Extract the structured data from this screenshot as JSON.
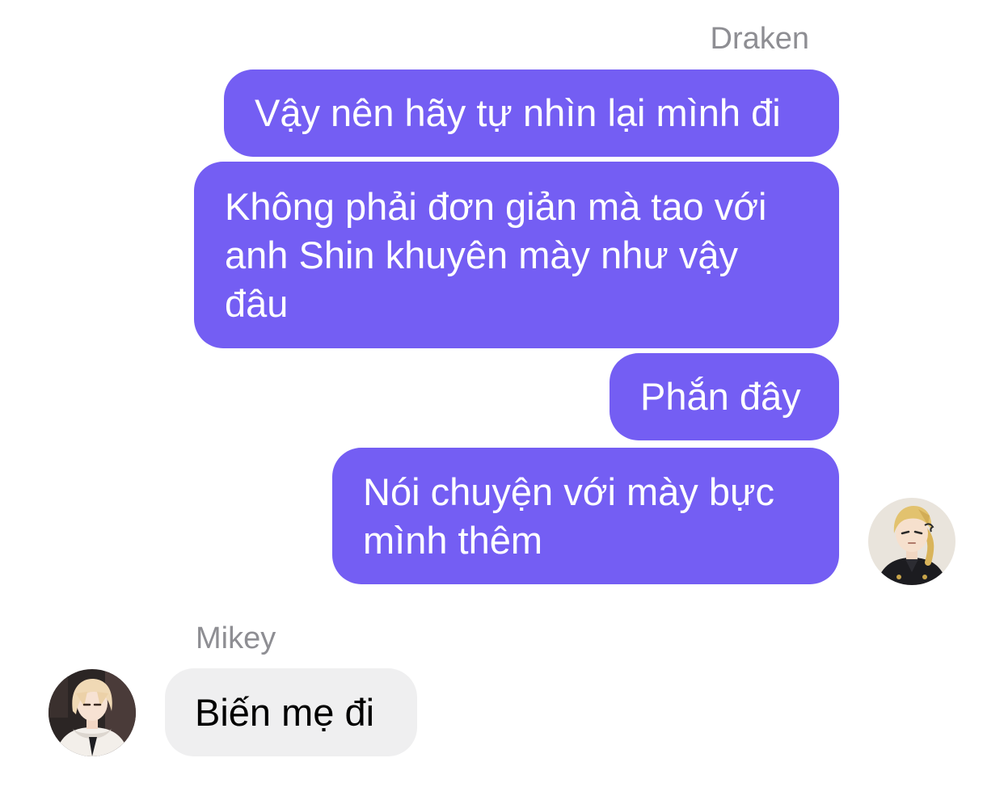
{
  "chat": {
    "outgoing": {
      "sender_name": "Draken",
      "messages": [
        "Vậy nên hãy tự nhìn lại mình đi",
        "Không phải đơn giản mà tao với anh Shin khuyên mày như vậy đâu",
        "Phắn đây",
        "Nói chuyện với mày bực mình thêm"
      ],
      "avatar_icon": "draken-avatar-icon",
      "bubble_color": "#745ef3"
    },
    "incoming": {
      "sender_name": "Mikey",
      "messages": [
        "Biến mẹ đi"
      ],
      "avatar_icon": "mikey-avatar-icon",
      "bubble_color": "#efeff0"
    }
  }
}
